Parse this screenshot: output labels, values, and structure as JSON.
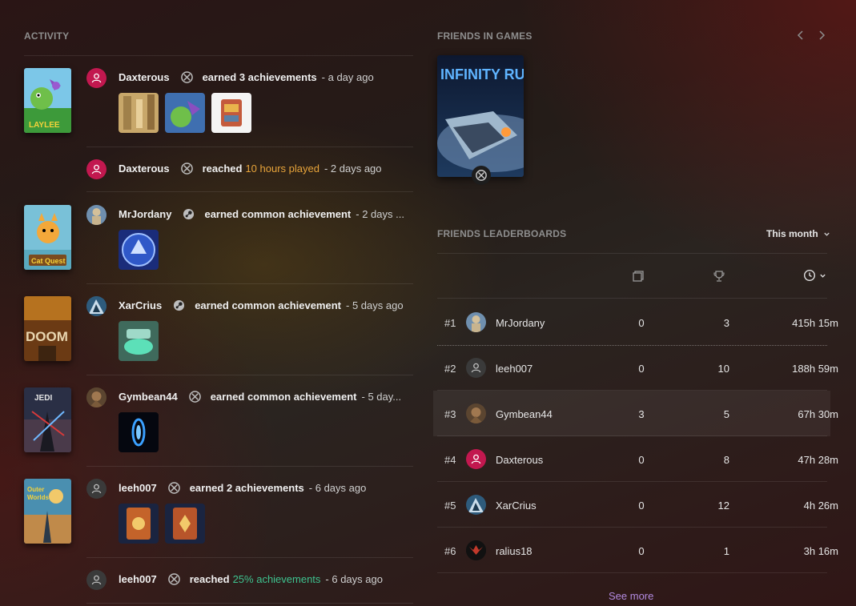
{
  "activity": {
    "title": "ACTIVITY",
    "entries": [
      {
        "rows": [
          {
            "user": "Daxterous",
            "platform": "xbox",
            "verb": "earned 3 achievements",
            "highlight": "",
            "when": "- a day ago"
          },
          {
            "user": "Daxterous",
            "platform": "xbox",
            "verb": "reached",
            "highlight": "10 hours played",
            "when": "- 2 days ago"
          }
        ]
      },
      {
        "rows": [
          {
            "user": "MrJordany",
            "platform": "steam",
            "verb": "earned common achievement",
            "highlight": "",
            "when": "- 2 days ..."
          }
        ]
      },
      {
        "rows": [
          {
            "user": "XarCrius",
            "platform": "steam",
            "verb": "earned common achievement",
            "highlight": "",
            "when": "- 5 days ago"
          }
        ]
      },
      {
        "rows": [
          {
            "user": "Gymbean44",
            "platform": "xbox",
            "verb": "earned common achievement",
            "highlight": "",
            "when": "- 5 day..."
          }
        ]
      },
      {
        "rows": [
          {
            "user": "leeh007",
            "platform": "xbox",
            "verb": "earned 2 achievements",
            "highlight": "",
            "when": "- 6 days ago"
          },
          {
            "user": "leeh007",
            "platform": "xbox",
            "verb": "reached",
            "highlight": "25% achievements",
            "when": "- 6 days ago"
          }
        ]
      }
    ]
  },
  "friends_in_games": {
    "title": "FRIENDS IN GAMES",
    "game_title": "INFINITY RUNNER"
  },
  "leaderboard": {
    "title": "FRIENDS LEADERBOARDS",
    "period": "This month",
    "see_more": "See more",
    "rows": [
      {
        "rank": "#1",
        "name": "MrJordany",
        "games": "0",
        "trophies": "3",
        "time": "415h 15m"
      },
      {
        "rank": "#2",
        "name": "leeh007",
        "games": "0",
        "trophies": "10",
        "time": "188h 59m"
      },
      {
        "rank": "#3",
        "name": "Gymbean44",
        "games": "3",
        "trophies": "5",
        "time": "67h 30m"
      },
      {
        "rank": "#4",
        "name": "Daxterous",
        "games": "0",
        "trophies": "8",
        "time": "47h 28m"
      },
      {
        "rank": "#5",
        "name": "XarCrius",
        "games": "0",
        "trophies": "12",
        "time": "4h 26m"
      },
      {
        "rank": "#6",
        "name": "ralius18",
        "games": "0",
        "trophies": "1",
        "time": "3h 16m"
      }
    ]
  },
  "colors": {
    "accent_link": "#b38be0",
    "highlight_orange": "#e7a43a",
    "highlight_green": "#3ec28f",
    "avatar_pink": "#c2184f"
  }
}
